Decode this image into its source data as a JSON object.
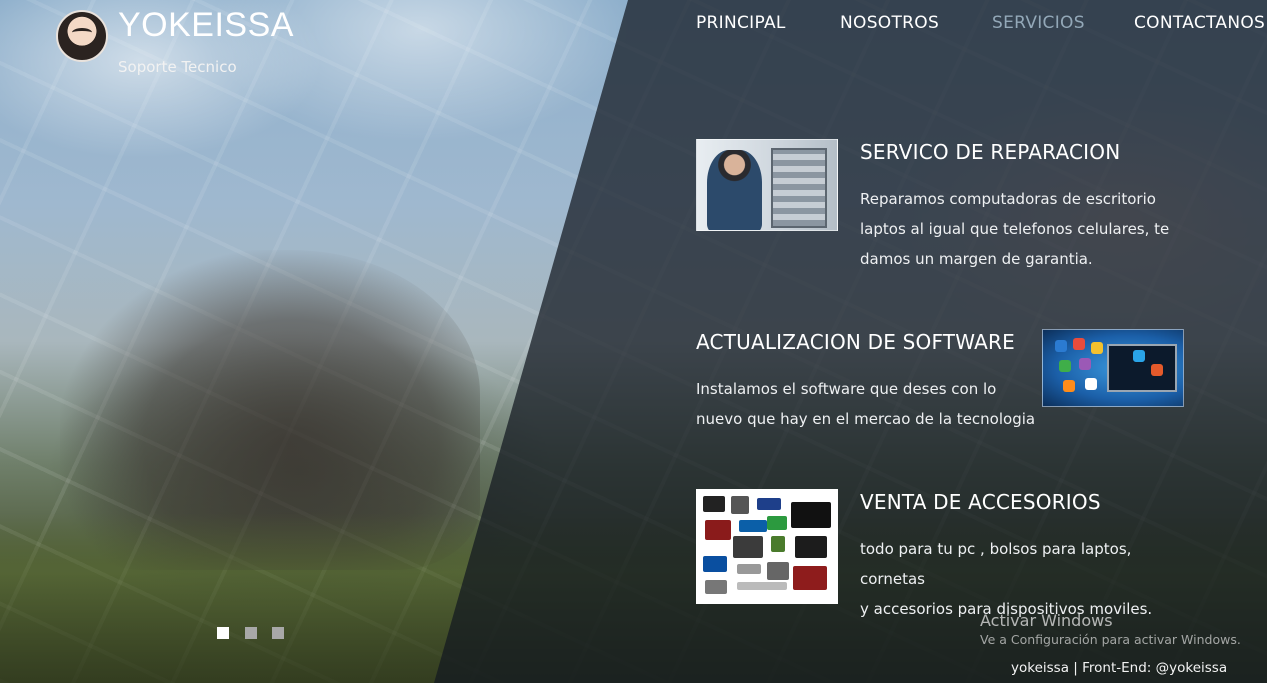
{
  "brand": {
    "name": "YOKEISSA",
    "tagline": "Soporte Tecnico"
  },
  "nav": {
    "items": [
      {
        "label": "PRINCIPAL",
        "active": false
      },
      {
        "label": "NOSOTROS",
        "active": false
      },
      {
        "label": "SERVICIOS",
        "active": true
      },
      {
        "label": "CONTACTANOS",
        "active": false
      }
    ]
  },
  "services": [
    {
      "title": "SERVICO DE REPARACION",
      "description_lines": [
        "Reparamos computadoras de escritorio",
        "laptos al igual que telefonos celulares, te",
        "damos un margen de garantia."
      ]
    },
    {
      "title": "ACTUALIZACION DE SOFTWARE",
      "description_lines": [
        "Instalamos el software que deses con lo",
        "nuevo que hay en el mercao de la tecnologia"
      ]
    },
    {
      "title": "VENTA DE ACCESORIOS",
      "description_lines": [
        "todo para tu pc , bolsos para laptos, cornetas",
        "y accesorios para dispositivos moviles."
      ]
    }
  ],
  "slider": {
    "dot_count": 3,
    "active_index": 0
  },
  "watermark": {
    "title": "Activar Windows",
    "subtitle": "Ve a Configuración para activar Windows."
  },
  "footer": {
    "credit": "yokeissa | Front-End: @yokeissa"
  },
  "colors": {
    "nav_active": "#93a8b8",
    "overlay": "#121820",
    "text": "#ffffff"
  }
}
